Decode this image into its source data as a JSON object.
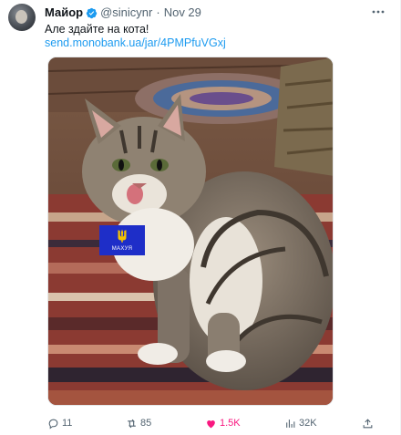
{
  "author": {
    "name": "Майор",
    "handle": "@sinicynr",
    "separator": "·",
    "date": "Nov 29"
  },
  "tweet": {
    "text": "Але здайте на кота!",
    "link": "send.monobank.ua/jar/4PMPfuVGxj"
  },
  "media": {
    "badge_text": "МАХУЯ",
    "badge_color": "#1e2ec8",
    "trident_color": "#f5c400"
  },
  "actions": {
    "replies": "11",
    "reposts": "85",
    "likes": "1.5K",
    "views": "32K"
  },
  "colors": {
    "accent": "#1d9bf0",
    "like": "#f91880",
    "muted": "#536471"
  }
}
